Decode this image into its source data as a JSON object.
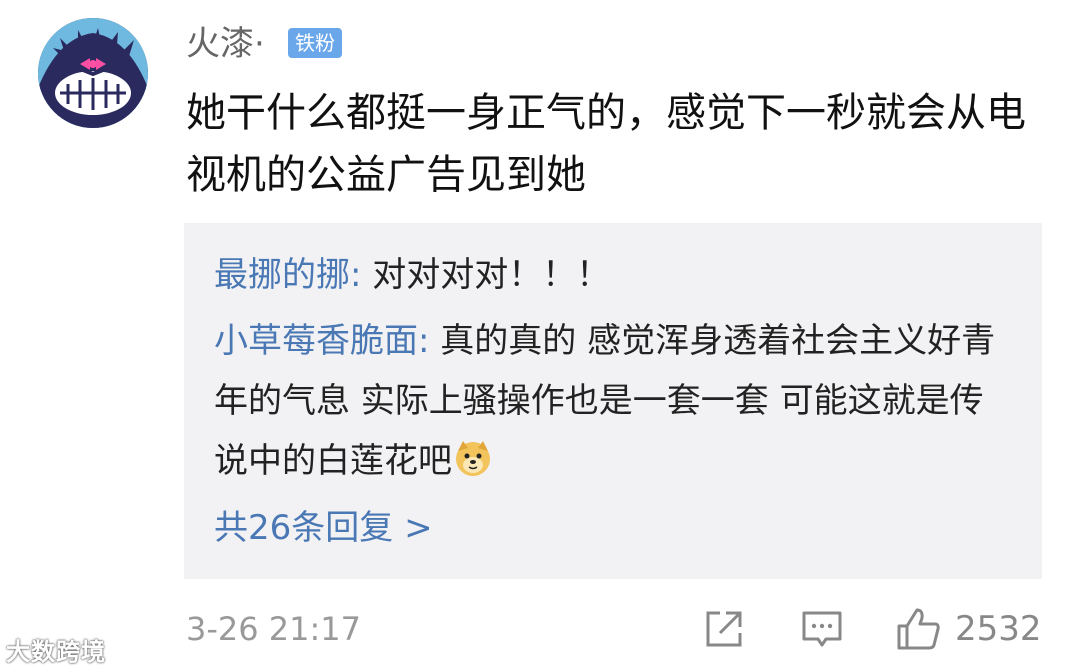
{
  "comment": {
    "username": "火漆·",
    "badge": "铁粉",
    "text": "她干什么都挺一身正气的，感觉下一秒就会从电视机的公益广告见到她",
    "timestamp": "3-26 21:17",
    "like_count": "2532"
  },
  "replies": [
    {
      "author": "最挪的挪",
      "separator": ": ",
      "text": "对对对对！！！"
    },
    {
      "author": "小草莓香脆面",
      "separator": ": ",
      "text": "真的真的   感觉浑身透着社会主义好青年的气息  实际上骚操作也是一套一套  可能这就是传说中的白莲花吧",
      "emoji": "doge-emoji"
    }
  ],
  "more_replies": "共26条回复 >",
  "watermark": "大数跨境",
  "icons": {
    "share": "share-icon",
    "reply": "comment-icon",
    "like": "thumbs-up-icon"
  },
  "colors": {
    "link_blue": "#4a78b5",
    "badge_blue": "#6aa6ea",
    "reply_bg": "#f2f2f4"
  }
}
